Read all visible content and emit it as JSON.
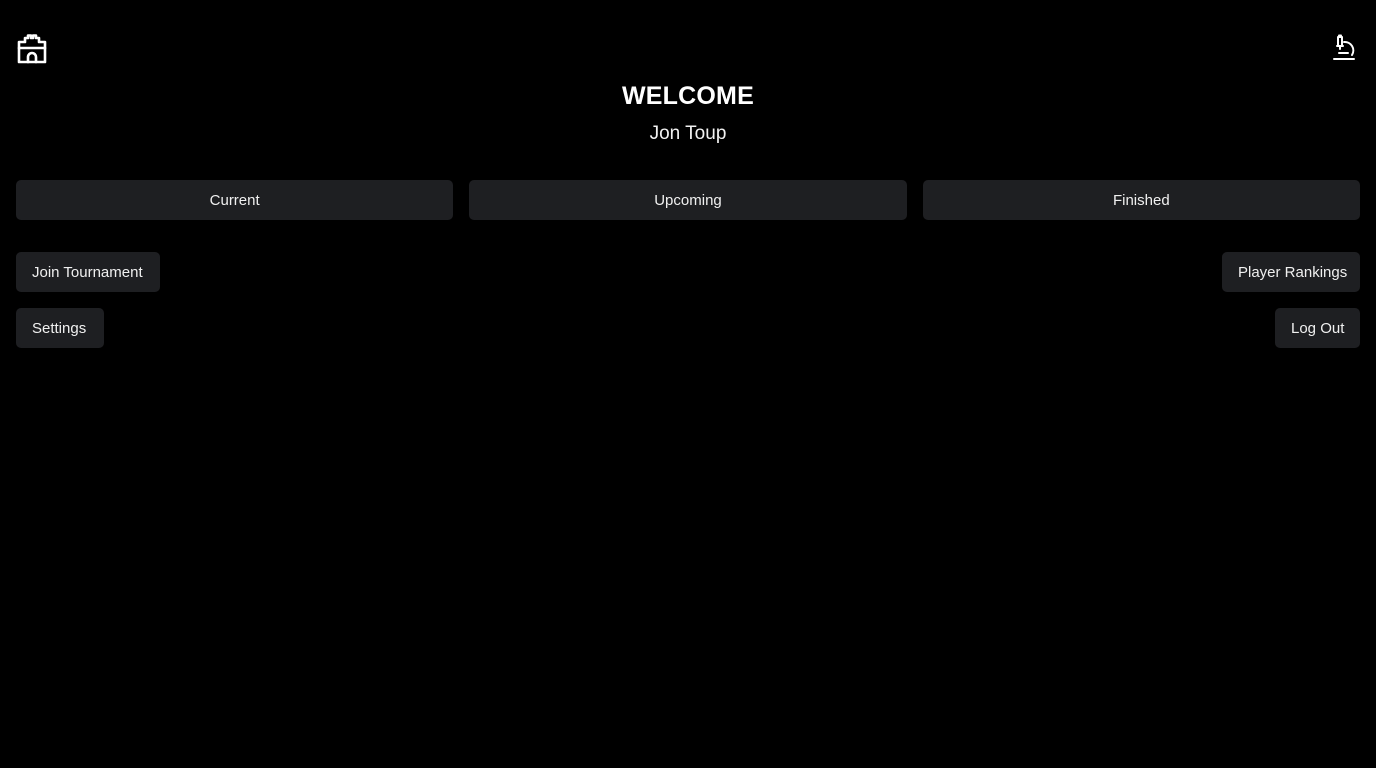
{
  "header": {
    "left_icon": "castle-icon",
    "right_icon": "microscope-icon"
  },
  "welcome": {
    "title": "WELCOME",
    "user_name": "Jon Toup"
  },
  "tabs": [
    {
      "label": "Current"
    },
    {
      "label": "Upcoming"
    },
    {
      "label": "Finished"
    }
  ],
  "actions": {
    "join_tournament": "Join Tournament",
    "settings": "Settings",
    "player_rankings": "Player Rankings",
    "log_out": "Log Out"
  },
  "colors": {
    "background": "#000000",
    "button_bg": "#1e1f22",
    "text": "#ffffff"
  }
}
